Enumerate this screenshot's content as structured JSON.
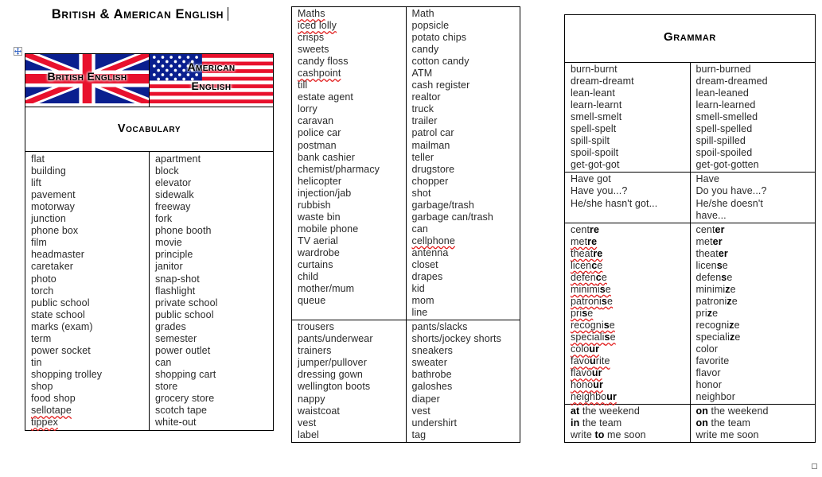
{
  "document": {
    "title": "British & American English",
    "caret_visible": true
  },
  "handles": {
    "move_handle_icon": "move-four-arrows-icon",
    "resize_handle_icon": "resize-handle-icon"
  },
  "vocabulary_table": {
    "banner": {
      "british_label": "British English",
      "american_label_line1": "American",
      "american_label_line2": "English",
      "uk_flag_icon": "union-jack-flag-icon",
      "us_flag_icon": "stars-and-stripes-flag-icon"
    },
    "section_heading": "Vocabulary",
    "british": [
      "flat",
      "building",
      "lift",
      "pavement",
      "motorway",
      "junction",
      "phone box",
      "film",
      "headmaster",
      "caretaker",
      "photo",
      "torch",
      "public school",
      "state school",
      "marks (exam)",
      "term",
      "power socket",
      "tin",
      "shopping trolley",
      "shop",
      "food shop",
      "sellotape",
      "tippex"
    ],
    "british_misspelled": [
      "sellotape",
      "tippex"
    ],
    "american": [
      "apartment",
      "block",
      "elevator",
      "sidewalk",
      "freeway",
      "fork",
      "phone booth",
      "movie",
      "principle",
      "janitor",
      "snap-shot",
      "flashlight",
      "private school",
      "public school",
      "grades",
      "semester",
      "power outlet",
      "can",
      "shopping cart",
      "store",
      "grocery store",
      "scotch tape",
      "white-out"
    ]
  },
  "middle_table": {
    "cells": [
      {
        "british": [
          "Maths",
          "iced lolly",
          "crisps",
          "sweets",
          "candy floss",
          "cashpoint",
          "till",
          "estate agent",
          "lorry",
          "caravan",
          "police car",
          "postman",
          "bank cashier",
          "chemist/pharmacy",
          "helicopter",
          "injection/jab",
          "rubbish",
          "waste bin",
          "mobile phone",
          "TV aerial",
          "wardrobe",
          "curtains",
          "child",
          "mother/mum",
          "queue"
        ],
        "british_misspelled": [
          "Maths",
          "iced lolly",
          "cashpoint"
        ],
        "american": [
          "Math",
          "popsicle",
          "potato chips",
          "candy",
          "cotton candy",
          "ATM",
          "cash register",
          "realtor",
          "truck",
          "trailer",
          "patrol car",
          "mailman",
          "teller",
          "drugstore",
          "chopper",
          "shot",
          "garbage/trash",
          "garbage can/trash",
          "can",
          "cellphone",
          "antenna",
          "closet",
          "drapes",
          "kid",
          "mom",
          "line"
        ],
        "american_misspelled": [
          "cellphone"
        ]
      },
      {
        "british": [
          "trousers",
          "pants/underwear",
          "trainers",
          "jumper/pullover",
          "dressing gown",
          "wellington boots",
          "nappy",
          "waistcoat",
          "vest",
          "label"
        ],
        "british_misspelled": [],
        "american": [
          "pants/slacks",
          "shorts/jockey shorts",
          "sneakers",
          "sweater",
          "bathrobe",
          "galoshes",
          "diaper",
          "vest",
          "undershirt",
          "tag"
        ],
        "american_misspelled": []
      }
    ]
  },
  "grammar_table": {
    "section_heading": "Grammar",
    "verbs": {
      "british": [
        "burn-burnt",
        "dream-dreamt",
        "lean-leant",
        "learn-learnt",
        "smell-smelt",
        "spell-spelt",
        "spill-spilt",
        "spoil-spoilt",
        "get-got-got"
      ],
      "american": [
        "burn-burned",
        "dream-dreamed",
        "lean-leaned",
        "learn-learned",
        "smell-smelled",
        "spell-spelled",
        "spill-spilled",
        "spoil-spoiled",
        "get-got-gotten"
      ]
    },
    "have_got": {
      "british": [
        "Have got",
        "Have you...?",
        "He/she hasn't got..."
      ],
      "american": [
        "Have",
        "Do you have...?",
        "He/she doesn't",
        "have..."
      ]
    },
    "spelling": {
      "british": [
        {
          "stem": "cent",
          "bold": "re",
          "misspelled": false
        },
        {
          "stem": "met",
          "bold": "re",
          "misspelled": true
        },
        {
          "stem": "theat",
          "bold": "re",
          "misspelled": true
        },
        {
          "stem": "licen",
          "bold": "c",
          "tail": "e",
          "misspelled": true
        },
        {
          "stem": "defen",
          "bold": "c",
          "tail": "e",
          "misspelled": true
        },
        {
          "stem": "minimi",
          "bold": "s",
          "tail": "e",
          "misspelled": true
        },
        {
          "stem": "patroni",
          "bold": "s",
          "tail": "e",
          "misspelled": true
        },
        {
          "stem": "pri",
          "bold": "s",
          "tail": "e",
          "misspelled": true
        },
        {
          "stem": "recogni",
          "bold": "s",
          "tail": "e",
          "misspelled": true
        },
        {
          "stem": "speciali",
          "bold": "s",
          "tail": "e",
          "misspelled": true
        },
        {
          "stem": "colo",
          "bold": "ur",
          "misspelled": true
        },
        {
          "stem": "favo",
          "bold": "u",
          "tail": "rite",
          "misspelled": true
        },
        {
          "stem": "flavo",
          "bold": "ur",
          "misspelled": true
        },
        {
          "stem": "hono",
          "bold": "ur",
          "misspelled": true
        },
        {
          "stem": "neighbo",
          "bold": "ur",
          "misspelled": true
        }
      ],
      "american": [
        {
          "stem": "cent",
          "bold": "er"
        },
        {
          "stem": "met",
          "bold": "er"
        },
        {
          "stem": "theat",
          "bold": "er"
        },
        {
          "stem": "licen",
          "bold": "s",
          "tail": "e"
        },
        {
          "stem": "defen",
          "bold": "s",
          "tail": "e"
        },
        {
          "stem": "minimi",
          "bold": "z",
          "tail": "e"
        },
        {
          "stem": "patroni",
          "bold": "z",
          "tail": "e"
        },
        {
          "stem": "pri",
          "bold": "z",
          "tail": "e"
        },
        {
          "stem": "recogni",
          "bold": "z",
          "tail": "e"
        },
        {
          "stem": "speciali",
          "bold": "z",
          "tail": "e"
        },
        {
          "stem": "color",
          "bold": ""
        },
        {
          "stem": "favorite",
          "bold": ""
        },
        {
          "stem": "flavor",
          "bold": ""
        },
        {
          "stem": "honor",
          "bold": ""
        },
        {
          "stem": "neighbor",
          "bold": ""
        }
      ]
    },
    "prepositions": {
      "british": [
        {
          "bold": "at",
          "rest": " the weekend",
          "bold_after": false
        },
        {
          "bold": "in",
          "rest": " the team",
          "bold_after": false
        },
        {
          "pre": "write ",
          "bold": "to",
          "rest": " me soon",
          "bold_after": true
        }
      ],
      "american": [
        {
          "bold": "on",
          "rest": " the weekend",
          "bold_after": false
        },
        {
          "bold": "on",
          "rest": " the team",
          "bold_after": false
        },
        {
          "plain": "write me soon"
        }
      ]
    }
  },
  "colors": {
    "flag_blue": "#0a1f8f",
    "flag_red": "#e8112d",
    "spellcheck_red": "#e11b1b",
    "text": "#2a2a2a",
    "border": "#000000"
  }
}
